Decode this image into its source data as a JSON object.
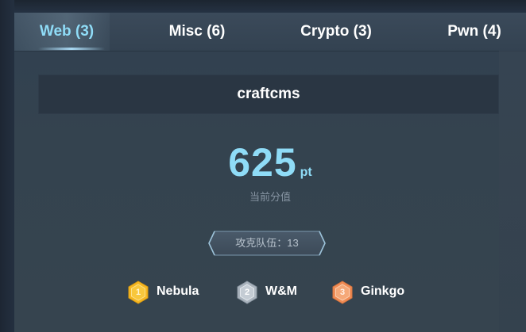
{
  "tabs": [
    {
      "label": "Web (3)",
      "active": true
    },
    {
      "label": "Misc (6)",
      "active": false
    },
    {
      "label": "Crypto (3)",
      "active": false
    },
    {
      "label": "Pwn (4)",
      "active": false
    }
  ],
  "challenge": {
    "name": "craftcms",
    "score": "625",
    "unit": "pt",
    "score_label": "当前分值",
    "teams_solved": "攻克队伍：13"
  },
  "top_solvers": [
    {
      "rank": "1",
      "name": "Nebula",
      "medal": "gold"
    },
    {
      "rank": "2",
      "name": "W&M",
      "medal": "silver"
    },
    {
      "rank": "3",
      "name": "Ginkgo",
      "medal": "bronze"
    }
  ],
  "colors": {
    "accent": "#8fdcf7",
    "gold": "#f5b622",
    "silver": "#b8c2cc",
    "bronze": "#f4a06a"
  }
}
